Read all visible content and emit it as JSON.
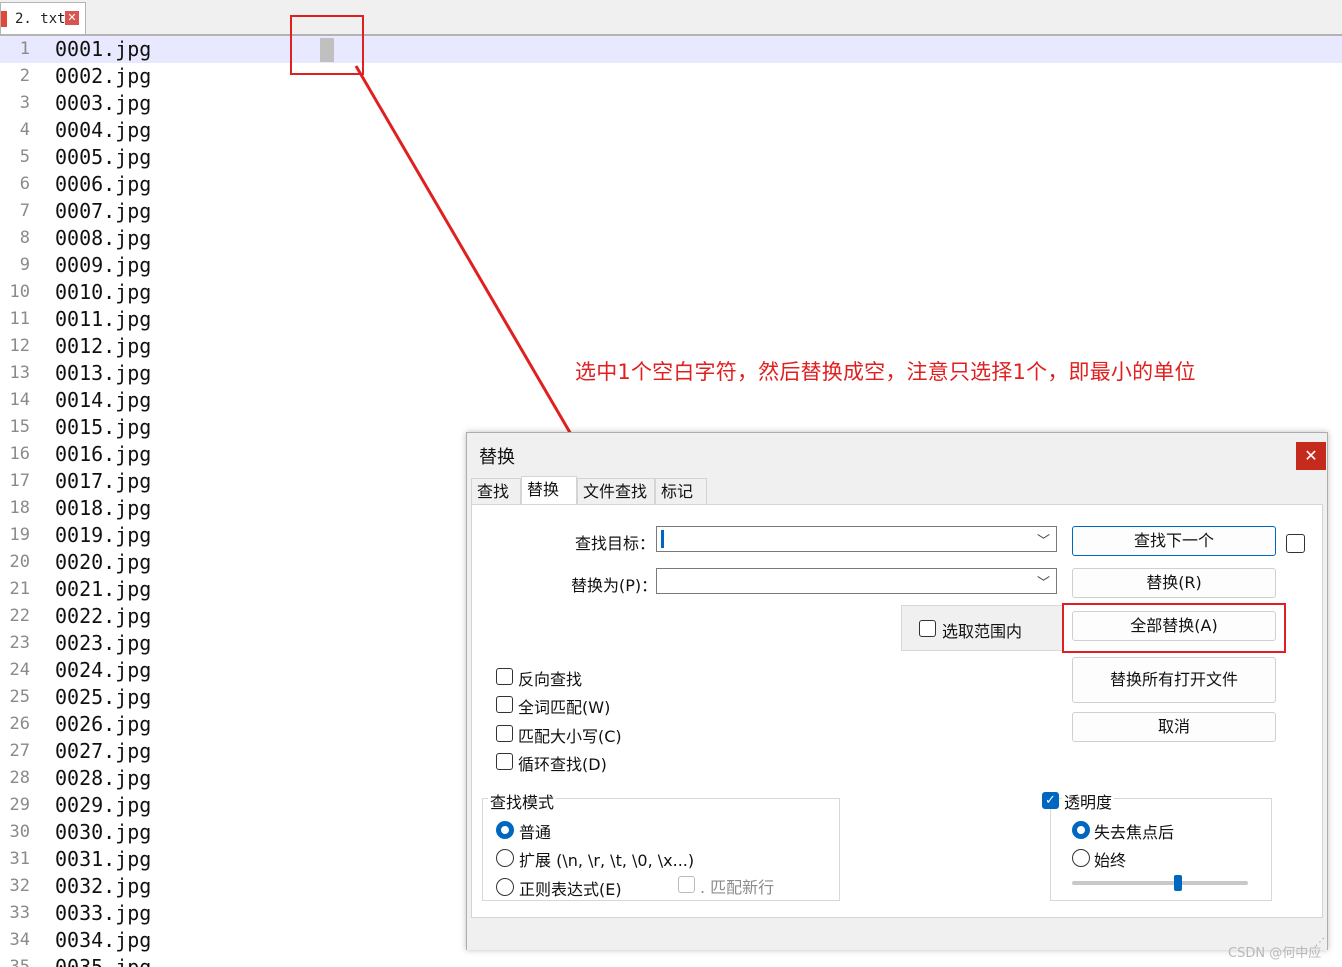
{
  "editor": {
    "tab_label": "2. txt",
    "tab_close": "✕",
    "lines": [
      {
        "n": "1",
        "t": "0001.jpg"
      },
      {
        "n": "2",
        "t": "0002.jpg"
      },
      {
        "n": "3",
        "t": "0003.jpg"
      },
      {
        "n": "4",
        "t": "0004.jpg"
      },
      {
        "n": "5",
        "t": "0005.jpg"
      },
      {
        "n": "6",
        "t": "0006.jpg"
      },
      {
        "n": "7",
        "t": "0007.jpg"
      },
      {
        "n": "8",
        "t": "0008.jpg"
      },
      {
        "n": "9",
        "t": "0009.jpg"
      },
      {
        "n": "10",
        "t": "0010.jpg"
      },
      {
        "n": "11",
        "t": "0011.jpg"
      },
      {
        "n": "12",
        "t": "0012.jpg"
      },
      {
        "n": "13",
        "t": "0013.jpg"
      },
      {
        "n": "14",
        "t": "0014.jpg"
      },
      {
        "n": "15",
        "t": "0015.jpg"
      },
      {
        "n": "16",
        "t": "0016.jpg"
      },
      {
        "n": "17",
        "t": "0017.jpg"
      },
      {
        "n": "18",
        "t": "0018.jpg"
      },
      {
        "n": "19",
        "t": "0019.jpg"
      },
      {
        "n": "20",
        "t": "0020.jpg"
      },
      {
        "n": "21",
        "t": "0021.jpg"
      },
      {
        "n": "22",
        "t": "0022.jpg"
      },
      {
        "n": "23",
        "t": "0023.jpg"
      },
      {
        "n": "24",
        "t": "0024.jpg"
      },
      {
        "n": "25",
        "t": "0025.jpg"
      },
      {
        "n": "26",
        "t": "0026.jpg"
      },
      {
        "n": "27",
        "t": "0027.jpg"
      },
      {
        "n": "28",
        "t": "0028.jpg"
      },
      {
        "n": "29",
        "t": "0029.jpg"
      },
      {
        "n": "30",
        "t": "0030.jpg"
      },
      {
        "n": "31",
        "t": "0031.jpg"
      },
      {
        "n": "32",
        "t": "0032.jpg"
      },
      {
        "n": "33",
        "t": "0033.jpg"
      },
      {
        "n": "34",
        "t": "0034.jpg"
      },
      {
        "n": "35",
        "t": "0035.jpg"
      }
    ]
  },
  "annotation": {
    "text": "选中1个空白字符，然后替换成空，注意只选择1个，即最小的单位",
    "color": "#e02020"
  },
  "dialog": {
    "title": "替换",
    "close": "✕",
    "tabs": [
      "查找",
      "替换",
      "文件查找",
      "标记"
    ],
    "active_tab": "替换",
    "find_label": "查找目标：",
    "replace_label": "替换为(P)：",
    "find_value": "",
    "replace_value": "",
    "buttons": {
      "find_next": "查找下一个",
      "replace": "替换(R)",
      "replace_all": "全部替换(A)",
      "replace_all_open": "替换所有打开文件",
      "cancel": "取消"
    },
    "in_selection": "选取范围内",
    "options": [
      "反向查找",
      "全词匹配(W)",
      "匹配大小写(C)",
      "循环查找(D)"
    ],
    "search_mode": {
      "legend": "查找模式",
      "normal": "普通",
      "extended": "扩展 (\\n, \\r, \\t, \\0, \\x...)",
      "regex": "正则表达式(E)",
      "dot_newline": ". 匹配新行",
      "selected": "普通"
    },
    "transparency": {
      "label": "透明度",
      "checked": true,
      "on_lose_focus": "失去焦点后",
      "always": "始终",
      "selected": "失去焦点后",
      "level": 0.6
    },
    "accent": "#0067c0"
  },
  "watermark": "CSDN @何中应"
}
